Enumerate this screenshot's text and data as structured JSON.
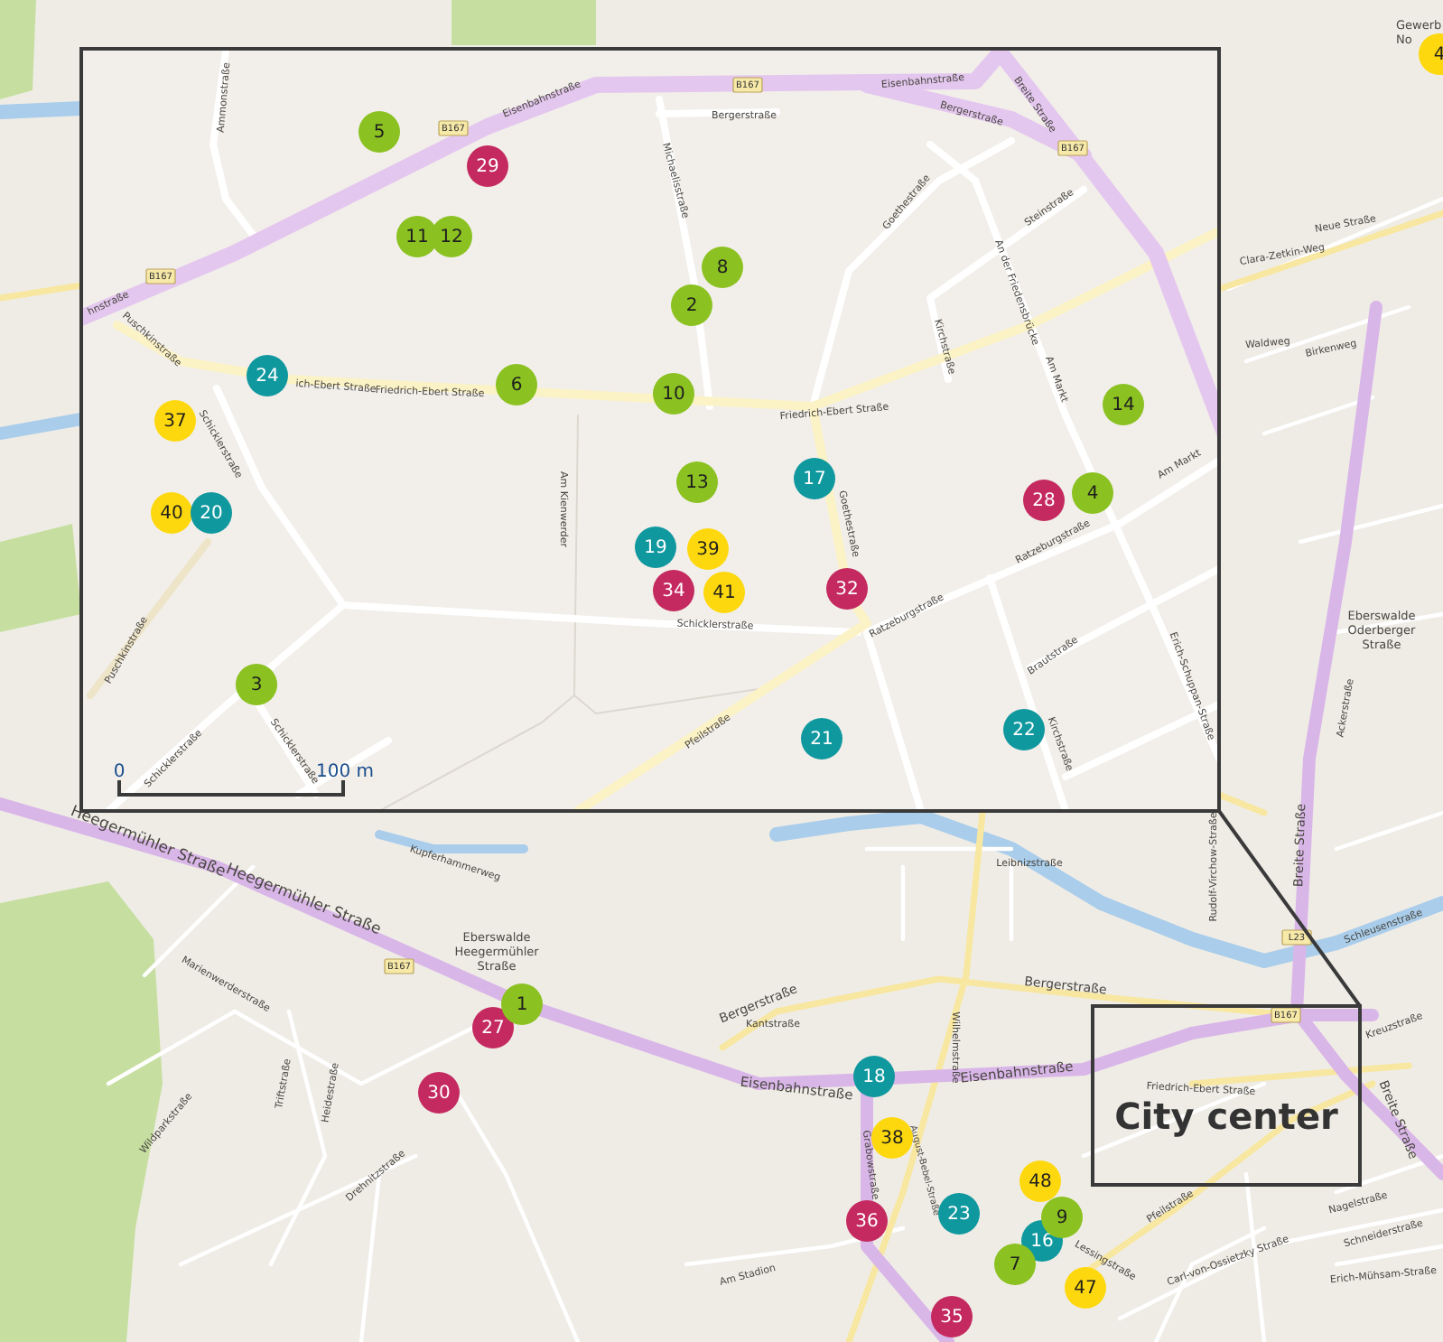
{
  "map": {
    "street_labels": [
      {
        "text": "Heegermühler Straße"
      },
      {
        "text": "Heegermühler Straße"
      },
      {
        "text": "Kupferhammerweg"
      },
      {
        "text": "Marienwerderstraße"
      },
      {
        "text": "Triftstraße"
      },
      {
        "text": "Heidestraße"
      },
      {
        "text": "Drehnitzstraße"
      },
      {
        "text": "Wildparkstraße"
      },
      {
        "text": "Bergerstraße"
      },
      {
        "text": "Bergerstraße"
      },
      {
        "text": "Kantstraße"
      },
      {
        "text": "Leibnizstraße"
      },
      {
        "text": "Eisenbahnstraße"
      },
      {
        "text": "Eisenbahnstraße"
      },
      {
        "text": "Friedrich-Ebert Straße"
      },
      {
        "text": "Wilhelmstraße"
      },
      {
        "text": "Rudolf-Virchow-Straße"
      },
      {
        "text": "Breite Straße"
      },
      {
        "text": "Breite Straße"
      },
      {
        "text": "Schleusenstraße"
      },
      {
        "text": "Kreuzstraße"
      },
      {
        "text": "Grabowstraße"
      },
      {
        "text": "August-Bebel-Straße"
      },
      {
        "text": "Lessingstraße"
      },
      {
        "text": "Carl-von-Ossietzky Straße"
      },
      {
        "text": "Nagelstraße"
      },
      {
        "text": "Schneiderstraße"
      },
      {
        "text": "Erich-Mühsam-Straße"
      },
      {
        "text": "Pfeilstraße"
      },
      {
        "text": "Am Stadion"
      },
      {
        "text": "Neue Straße"
      },
      {
        "text": "Clara-Zetkin-Weg"
      },
      {
        "text": "Waldweg"
      },
      {
        "text": "Birkenweg"
      },
      {
        "text": "Ackerstraße"
      }
    ],
    "place_labels": [
      {
        "lines": [
          "Eberswalde",
          "Heegermühler",
          "Straße"
        ]
      },
      {
        "lines": [
          "Eberswalde",
          "Oderberger",
          "Straße"
        ]
      },
      {
        "lines": [
          "Gewerb",
          "No"
        ]
      }
    ],
    "road_shields": [
      "B167",
      "B167",
      "L23"
    ],
    "markers": [
      {
        "label": "4",
        "color": "#fdd80f"
      },
      {
        "label": "27",
        "color": "#c42a5f"
      },
      {
        "label": "1",
        "color": "#8bc121"
      },
      {
        "label": "30",
        "color": "#c42a5f"
      },
      {
        "label": "18",
        "color": "#10989f"
      },
      {
        "label": "38",
        "color": "#fdd80f"
      },
      {
        "label": "48",
        "color": "#fdd80f"
      },
      {
        "label": "36",
        "color": "#c42a5f"
      },
      {
        "label": "23",
        "color": "#10989f"
      },
      {
        "label": "16",
        "color": "#10989f"
      },
      {
        "label": "9",
        "color": "#8bc121"
      },
      {
        "label": "7",
        "color": "#8bc121"
      },
      {
        "label": "47",
        "color": "#fdd80f"
      },
      {
        "label": "35",
        "color": "#c42a5f"
      }
    ]
  },
  "inset": {
    "street_labels": [
      {
        "text": "Eisenbahnstraße"
      },
      {
        "text": "Eisenbahnstraße"
      },
      {
        "text": "hnstraße"
      },
      {
        "text": "Bergerstraße"
      },
      {
        "text": "Bergerstraße"
      },
      {
        "text": "Breite Straße"
      },
      {
        "text": "Michaelisstraße"
      },
      {
        "text": "Goethestraße"
      },
      {
        "text": "Goethestraße"
      },
      {
        "text": "Steinstraße"
      },
      {
        "text": "An der Friedensbrücke"
      },
      {
        "text": "Am Markt"
      },
      {
        "text": "Kirchstraße"
      },
      {
        "text": "Friedrich-Ebert Straße"
      },
      {
        "text": "ich-Ebert Straße"
      },
      {
        "text": "Friedrich-Ebert Straße"
      },
      {
        "text": "Puschkinstraße"
      },
      {
        "text": "Puschkinstraße"
      },
      {
        "text": "Schicklerstraße"
      },
      {
        "text": "Schicklerstraße"
      },
      {
        "text": "Schicklerstraße"
      },
      {
        "text": "Schicklerstraße"
      },
      {
        "text": "Am Kienwerder"
      },
      {
        "text": "Ratzeburgstraße"
      },
      {
        "text": "Ratzeburgstraße"
      },
      {
        "text": "Am Markt"
      },
      {
        "text": "Pfeilstraße"
      },
      {
        "text": "Brautstraße"
      },
      {
        "text": "Kirchstraße"
      },
      {
        "text": "Erich-Schuppan-Straße"
      },
      {
        "text": "Ammonstraße"
      }
    ],
    "road_shields": [
      "B167",
      "B167",
      "B167",
      "B167"
    ],
    "markers": [
      {
        "label": "5",
        "color": "#8bc121"
      },
      {
        "label": "29",
        "color": "#c42a5f"
      },
      {
        "label": "11",
        "color": "#8bc121"
      },
      {
        "label": "12",
        "color": "#8bc121"
      },
      {
        "label": "8",
        "color": "#8bc121"
      },
      {
        "label": "2",
        "color": "#8bc121"
      },
      {
        "label": "24",
        "color": "#10989f"
      },
      {
        "label": "6",
        "color": "#8bc121"
      },
      {
        "label": "10",
        "color": "#8bc121"
      },
      {
        "label": "14",
        "color": "#8bc121"
      },
      {
        "label": "37",
        "color": "#fdd80f"
      },
      {
        "label": "13",
        "color": "#8bc121"
      },
      {
        "label": "17",
        "color": "#10989f"
      },
      {
        "label": "28",
        "color": "#c42a5f"
      },
      {
        "label": "4",
        "color": "#8bc121"
      },
      {
        "label": "40",
        "color": "#fdd80f"
      },
      {
        "label": "20",
        "color": "#10989f"
      },
      {
        "label": "19",
        "color": "#10989f"
      },
      {
        "label": "39",
        "color": "#fdd80f"
      },
      {
        "label": "34",
        "color": "#c42a5f"
      },
      {
        "label": "41",
        "color": "#fdd80f"
      },
      {
        "label": "32",
        "color": "#c42a5f"
      },
      {
        "label": "3",
        "color": "#8bc121"
      },
      {
        "label": "21",
        "color": "#10989f"
      },
      {
        "label": "22",
        "color": "#10989f"
      }
    ],
    "scale_bar": {
      "start": "0",
      "end": "100 m"
    }
  },
  "callout": {
    "label": "City center"
  }
}
